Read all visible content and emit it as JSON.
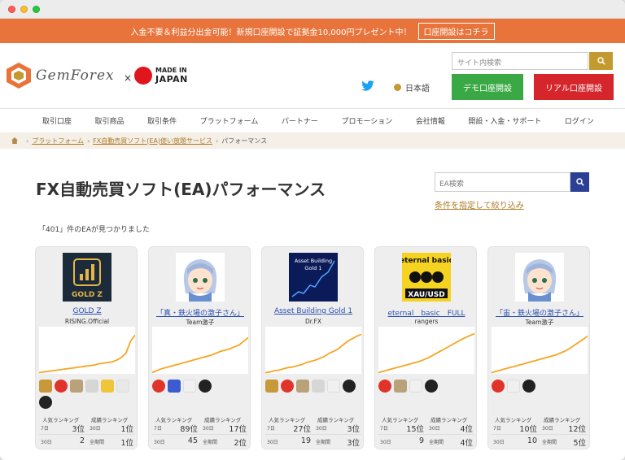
{
  "promo": {
    "text": "入金不要＆利益分出金可能！新規口座開設で証拠金10,000円プレゼント中！",
    "button": "口座開設はコチラ"
  },
  "header": {
    "logo_text": "GemForex",
    "times": "×",
    "made_in": "MADE IN",
    "japan": "JAPAN",
    "search_placeholder": "サイト内検索",
    "language": "日本語",
    "demo_button": "デモ口座開設",
    "real_button": "リアル口座開設"
  },
  "nav": {
    "items": [
      "取引口座",
      "取引商品",
      "取引条件",
      "プラットフォーム",
      "パートナー",
      "プロモーション",
      "会社情報",
      "開設・入金・サポート",
      "ログイン"
    ]
  },
  "breadcrumb": {
    "items": [
      "プラットフォーム",
      "FX自動売買ソフト(EA)使い放題サービス"
    ],
    "current": "パフォーマンス"
  },
  "main": {
    "title": "FX自動売買ソフト(EA)パフォーマンス",
    "ea_search_placeholder": "EA検索",
    "filter_link": "条件を指定して絞り込み",
    "result_count": "「401」件のEAが見つかりました"
  },
  "ranking_labels": {
    "popular": "人気ランキング",
    "performance": "成績ランキング",
    "d7": "7日",
    "d30": "30日",
    "all": "全期間"
  },
  "cards": [
    {
      "name": "GOLD Z",
      "author": "RISING.Official",
      "thumb_text": "GOLD Z",
      "pop7": "3位",
      "perf30": "1位",
      "pop30": "2",
      "perfAll": "1位",
      "curve": [
        2,
        3,
        4,
        5,
        6,
        7,
        8,
        9,
        10,
        11,
        12,
        13,
        14,
        16,
        17,
        18,
        19,
        22,
        26,
        33,
        52,
        62
      ]
    },
    {
      "name": "「真・鉄火場の激子さん」",
      "author": "Team激子",
      "thumb_text": "",
      "pop7": "89位",
      "perf30": "17位",
      "pop30": "45",
      "perfAll": "2位",
      "curve": [
        2,
        5,
        8,
        10,
        12,
        14,
        16,
        18,
        20,
        22,
        24,
        26,
        28,
        30,
        33,
        36,
        38,
        40,
        43,
        46,
        52,
        58
      ]
    },
    {
      "name": "Asset Building Gold 1",
      "author": "Dr.FX",
      "thumb_text": "Asset Building Gold 1",
      "pop7": "27位",
      "perf30": "3位",
      "pop30": "19",
      "perfAll": "3位",
      "curve": [
        2,
        3,
        5,
        6,
        8,
        10,
        11,
        13,
        15,
        18,
        20,
        22,
        25,
        28,
        33,
        36,
        40,
        46,
        52,
        56,
        60,
        63
      ]
    },
    {
      "name": "eternal　basic　FULL",
      "author": "rangers",
      "thumb_text": "eternal basic",
      "pop7": "15位",
      "perf30": "4位",
      "pop30": "9",
      "perfAll": "4位",
      "curve": [
        2,
        4,
        6,
        8,
        10,
        12,
        14,
        16,
        18,
        20,
        23,
        26,
        30,
        34,
        38,
        42,
        46,
        50,
        54,
        58,
        61,
        64
      ]
    },
    {
      "name": "「宙・鉄火場の激子さん」",
      "author": "Team激子",
      "thumb_text": "",
      "pop7": "10位",
      "perf30": "12位",
      "pop30": "10",
      "perfAll": "5位",
      "curve": [
        2,
        4,
        6,
        8,
        10,
        12,
        14,
        16,
        18,
        20,
        22,
        24,
        26,
        28,
        30,
        33,
        36,
        40,
        45,
        50,
        55,
        60
      ]
    }
  ],
  "colors": {
    "promo_bg": "#e8743b",
    "gold": "#c39a2f",
    "demo_green": "#3aa845",
    "real_red": "#d4262b",
    "curve": "#f5a623",
    "link_blue": "#2b4fb0",
    "search_blue": "#2b3f94"
  }
}
